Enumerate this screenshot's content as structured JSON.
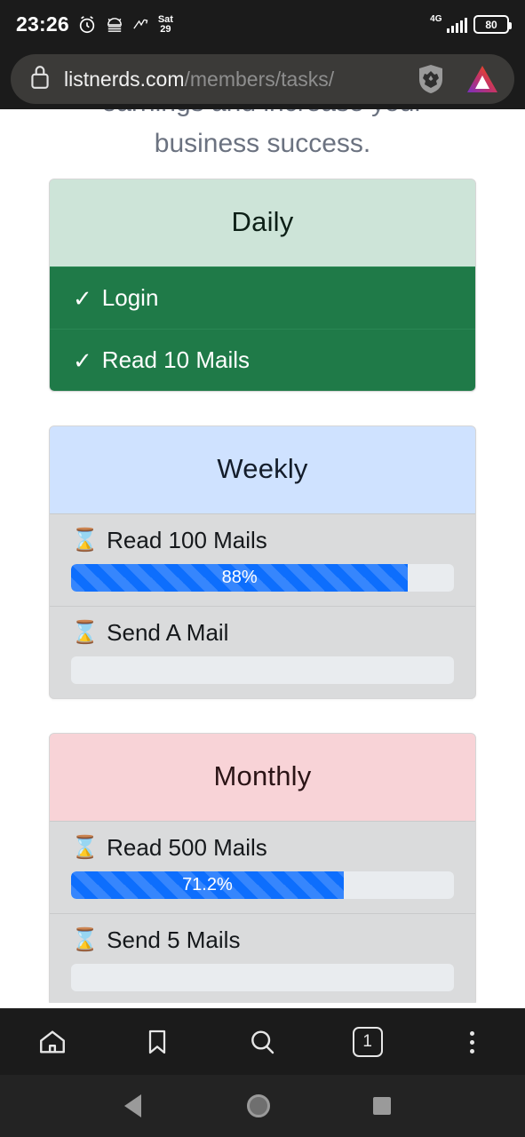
{
  "status_bar": {
    "time": "23:26",
    "date": "Sat\n29",
    "date_day": "Sat",
    "date_num": "29",
    "network": "4G",
    "battery": "80",
    "icons": [
      "alarm-icon",
      "android-icon",
      "activity-icon"
    ]
  },
  "url_bar": {
    "lock_icon": "lock-icon",
    "domain": "listnerds.com",
    "path": "/members/tasks/",
    "shield_icon": "brave-shield-icon",
    "rewards_icon": "brave-bat-logo"
  },
  "page": {
    "intro_line1": "earnings and increase your",
    "intro_line2": "business success.",
    "cards": [
      {
        "title": "Daily",
        "header_color": "#cde4d8",
        "tasks": [
          {
            "label": "Login",
            "state": "done",
            "icon": "check-icon"
          },
          {
            "label": "Read 10 Mails",
            "state": "done",
            "icon": "check-icon"
          }
        ]
      },
      {
        "title": "Weekly",
        "header_color": "#cfe2ff",
        "tasks": [
          {
            "label": "Read 100 Mails",
            "state": "pending",
            "icon": "hourglass-icon",
            "percent_label": "88%",
            "percent": 88
          },
          {
            "label": "Send A Mail",
            "state": "pending",
            "icon": "hourglass-icon",
            "percent_label": "",
            "percent": 0
          }
        ]
      },
      {
        "title": "Monthly",
        "header_color": "#f8d3d7",
        "tasks": [
          {
            "label": "Read 500 Mails",
            "state": "pending",
            "icon": "hourglass-icon",
            "percent_label": "71.2%",
            "percent": 71.2
          },
          {
            "label": "Send 5 Mails",
            "state": "pending",
            "icon": "hourglass-icon",
            "percent_label": "",
            "percent": 0
          }
        ]
      }
    ]
  },
  "browser_bar": {
    "items": [
      {
        "name": "home-icon"
      },
      {
        "name": "bookmark-icon"
      },
      {
        "name": "search-icon"
      },
      {
        "name": "tabs-icon",
        "count": "1"
      },
      {
        "name": "more-menu-icon"
      }
    ]
  },
  "nav_bar": {
    "back": "back-icon",
    "home": "home-circle-icon",
    "recents": "recents-icon"
  }
}
